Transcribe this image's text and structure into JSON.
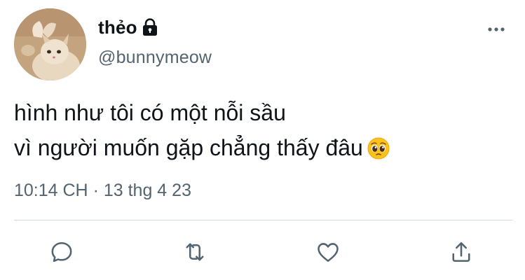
{
  "author": {
    "display_name": "thẻo",
    "handle": "@bunnymeow",
    "protected_icon": "lock-icon",
    "avatar_icon": "kitten-avatar"
  },
  "tweet": {
    "lines": [
      "hình như tôi có một nỗi sầu",
      "vì người muốn gặp chẳng thấy đâu"
    ],
    "emoji": "pleading-face-emoji"
  },
  "meta": {
    "time": "10:14 CH",
    "separator": "·",
    "date": "13 thg 4 23"
  },
  "actions": {
    "icons": [
      "reply-icon",
      "retweet-icon",
      "like-icon",
      "share-icon"
    ]
  },
  "colors": {
    "text_primary": "#0f1419",
    "text_secondary": "#536471",
    "divider": "#cfd9de",
    "icon": "#536471"
  }
}
